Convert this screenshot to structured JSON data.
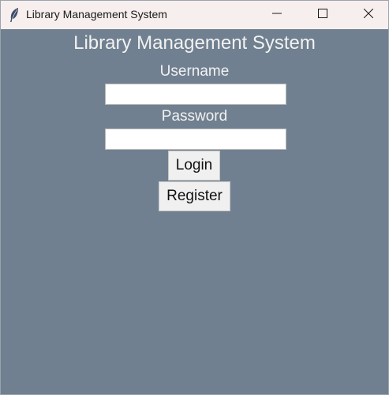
{
  "window": {
    "title": "Library Management System",
    "icon": "feather-icon",
    "controls": [
      "minimize-icon",
      "maximize-icon",
      "close-icon"
    ]
  },
  "login": {
    "heading": "Library Management System",
    "username_label": "Username",
    "username_value": "",
    "password_label": "Password",
    "password_value": "",
    "login_label": "Login",
    "register_label": "Register"
  },
  "colors": {
    "background": "#708090",
    "titlebar": "#f7eeee",
    "label_text": "#f2f2f2",
    "button_face": "#f0f0f0"
  }
}
